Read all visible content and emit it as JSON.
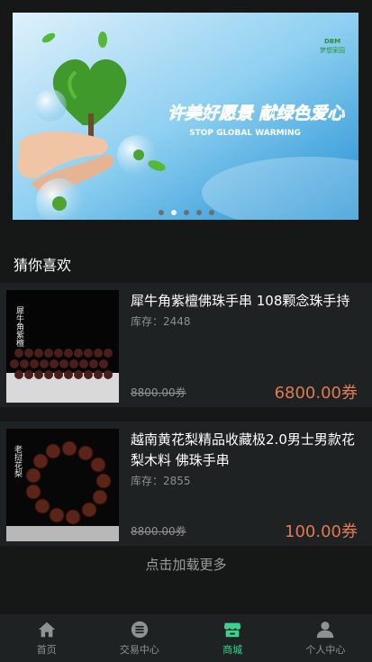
{
  "banner": {
    "headline": "许美好愿景 献绿色爱心",
    "subline": "STOP GLOBAL WARMING",
    "logo_text": "DBM\n梦想家园",
    "slide_count": 5,
    "active_slide": 1
  },
  "section": {
    "title": "猜你喜欢"
  },
  "products": [
    {
      "title": "犀牛角紫檀佛珠手串 108颗念珠手持",
      "stock": "库存：2448",
      "old_price": "8800.00券",
      "price": "6800.00券",
      "image_caption": "犀牛角紫檀"
    },
    {
      "title": "越南黄花梨精品收藏极2.0男士男款花梨木料 佛珠手串",
      "stock": "库存：2855",
      "old_price": "8800.00券",
      "price": "100.00券",
      "image_caption": "老挝花梨"
    }
  ],
  "load_more": "点击加载更多",
  "tabbar": {
    "items": [
      {
        "label": "首页",
        "icon": "home-icon"
      },
      {
        "label": "交易中心",
        "icon": "list-circle-icon"
      },
      {
        "label": "商城",
        "icon": "shop-icon"
      },
      {
        "label": "个人中心",
        "icon": "person-icon"
      }
    ],
    "active_index": 2,
    "active_color": "#3fcf8e",
    "inactive_color": "#8f9292"
  },
  "colors": {
    "background": "#161818",
    "card": "#1e2222",
    "price": "#e07a55"
  }
}
